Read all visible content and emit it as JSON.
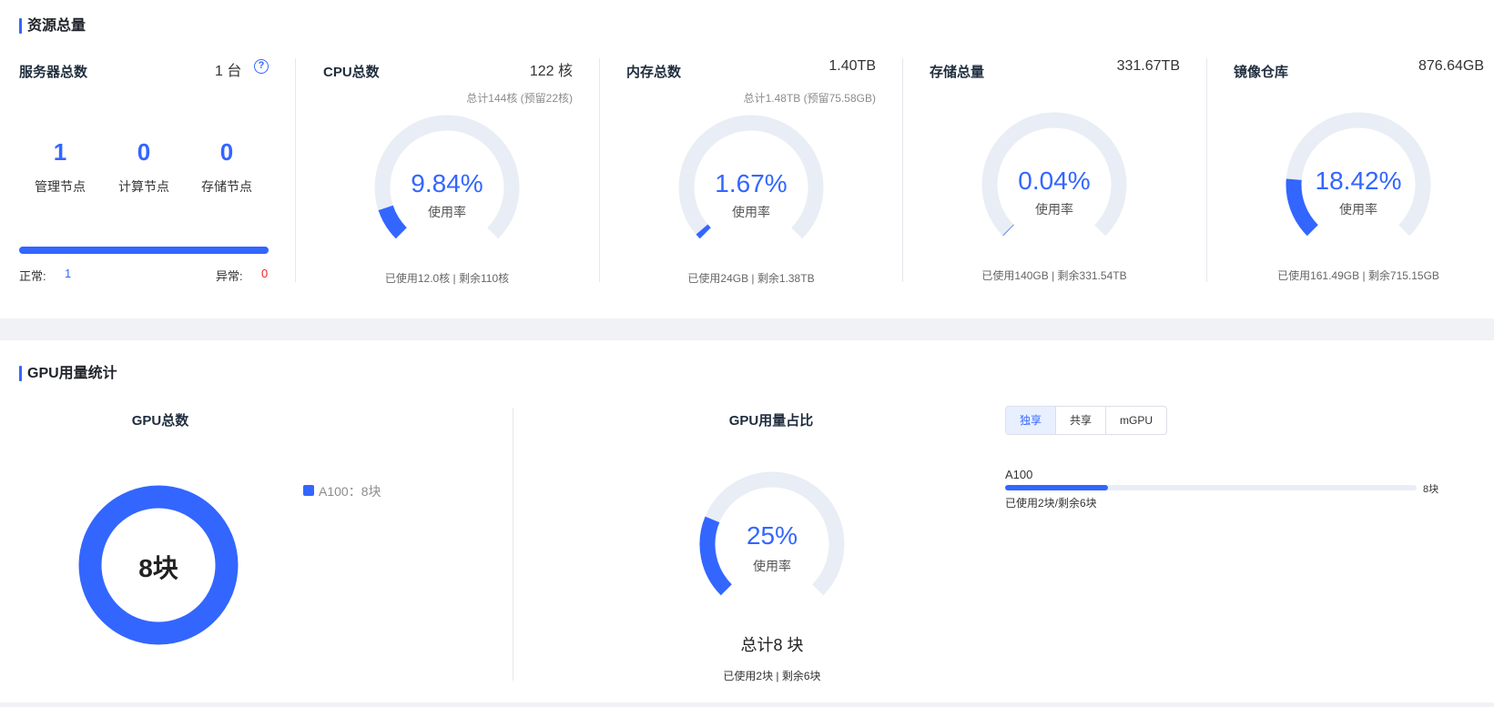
{
  "resources": {
    "title": "资源总量",
    "servers": {
      "title": "服务器总数",
      "total": "1 台",
      "nodes": [
        {
          "count": "1",
          "label": "管理节点"
        },
        {
          "count": "0",
          "label": "计算节点"
        },
        {
          "count": "0",
          "label": "存储节点"
        }
      ],
      "normal_label": "正常:",
      "normal_value": "1",
      "abnormal_label": "异常:",
      "abnormal_value": "0",
      "normal_fraction": 1.0
    },
    "cards": [
      {
        "title": "CPU总数",
        "total": "122 核",
        "sub": "总计144核 (预留22核)",
        "percent": "9.84%",
        "value": 9.84,
        "caption": "使用率",
        "footer": "已使用12.0核 | 剩余110核"
      },
      {
        "title": "内存总数",
        "total": "1.40TB",
        "sub": "总计1.48TB (预留75.58GB)",
        "percent": "1.67%",
        "value": 1.67,
        "caption": "使用率",
        "footer": "已使用24GB | 剩余1.38TB"
      },
      {
        "title": "存储总量",
        "total": "331.67TB",
        "sub": "",
        "percent": "0.04%",
        "value": 0.04,
        "caption": "使用率",
        "footer": "已使用140GB | 剩余331.54TB"
      },
      {
        "title": "镜像仓库",
        "total": "876.64GB",
        "sub": "",
        "percent": "18.42%",
        "value": 18.42,
        "caption": "使用率",
        "footer": "已使用161.49GB | 剩余715.15GB"
      }
    ]
  },
  "gpu": {
    "title": "GPU用量统计",
    "total_panel": {
      "title": "GPU总数",
      "center_text": "8块",
      "legend": [
        {
          "label": "A100：8块",
          "color": "#3366ff"
        }
      ]
    },
    "usage_panel": {
      "title": "GPU用量占比",
      "percent": "25%",
      "value": 25,
      "caption": "使用率",
      "total_text": "总计8 块",
      "footer": "已使用2块 | 剩余6块"
    },
    "tabs": [
      "独享",
      "共享",
      "mGPU"
    ],
    "active_tab": 0,
    "bars": [
      {
        "name": "A100",
        "used_fraction": 0.25,
        "total_label": "8块",
        "detail": "已使用2块/剩余6块"
      }
    ]
  },
  "colors": {
    "accent": "#3366ff",
    "track": "#e9edf5",
    "danger": "#f5222d"
  }
}
